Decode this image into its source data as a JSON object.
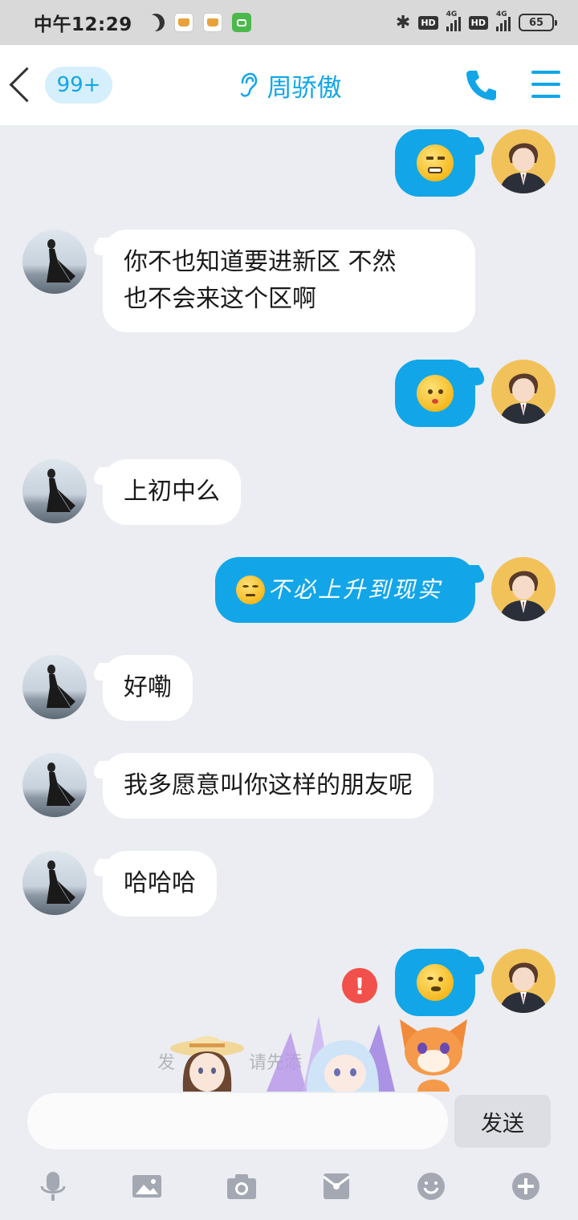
{
  "status_bar": {
    "time": "中午12:29",
    "network_1": "4G",
    "network_2": "4G",
    "hd_1": "HD",
    "hd_2": "HD",
    "battery": "65"
  },
  "header": {
    "unread_badge": "99+",
    "title": "周骄傲",
    "accent_color": "#12a6e8"
  },
  "messages": [
    {
      "side": "right",
      "type": "emoji",
      "emoji": "annoyed-face"
    },
    {
      "side": "left",
      "type": "text",
      "line1": "你不也知道要进新区  不然",
      "line2": "也不会来这个区啊"
    },
    {
      "side": "right",
      "type": "emoji",
      "emoji": "confused-face"
    },
    {
      "side": "left",
      "type": "text",
      "text": "上初中么"
    },
    {
      "side": "right",
      "type": "mixed",
      "emoji": "smirk-face",
      "text": "不必上升到现实"
    },
    {
      "side": "left",
      "type": "text",
      "text": "好嘞"
    },
    {
      "side": "left",
      "type": "text",
      "text": "我多愿意叫你这样的朋友呢"
    },
    {
      "side": "left",
      "type": "text",
      "text": "哈哈哈"
    },
    {
      "side": "right",
      "type": "emoji",
      "emoji": "thinking-face",
      "status": "failed"
    }
  ],
  "hint": {
    "part1": "发",
    "part2": "请先添"
  },
  "input": {
    "value": "",
    "send_label": "发送"
  },
  "toolbar": [
    "microphone-icon",
    "image-icon",
    "camera-icon",
    "red-packet-icon",
    "emoji-icon",
    "plus-icon"
  ]
}
